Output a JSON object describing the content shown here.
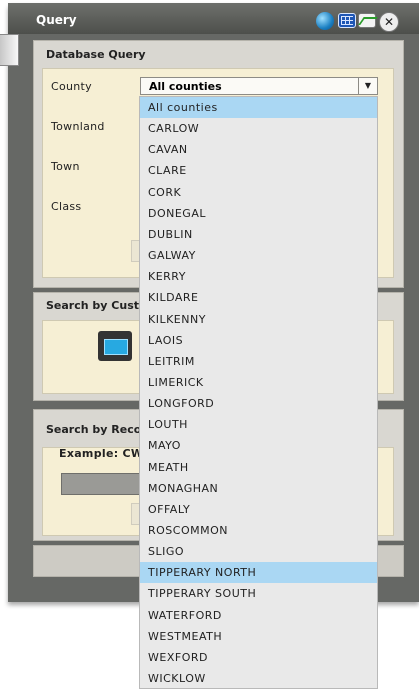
{
  "window": {
    "title": "Query"
  },
  "database_query": {
    "heading": "Database Query",
    "county_label": "County",
    "townland_label": "Townland",
    "town_label": "Town",
    "class_label": "Class",
    "county_value": "All counties"
  },
  "search_custom": {
    "heading": "Search by Custo"
  },
  "search_record": {
    "heading": "Search by Recor",
    "example": "Example: CW0"
  },
  "county_options": [
    "All counties",
    "CARLOW",
    "CAVAN",
    "CLARE",
    "CORK",
    "DONEGAL",
    "DUBLIN",
    "GALWAY",
    "KERRY",
    "KILDARE",
    "KILKENNY",
    "LAOIS",
    "LEITRIM",
    "LIMERICK",
    "LONGFORD",
    "LOUTH",
    "MAYO",
    "MEATH",
    "MONAGHAN",
    "OFFALY",
    "ROSCOMMON",
    "SLIGO",
    "TIPPERARY NORTH",
    "TIPPERARY SOUTH",
    "WATERFORD",
    "WESTMEATH",
    "WEXFORD",
    "WICKLOW"
  ],
  "highlighted_options": [
    "All counties",
    "TIPPERARY NORTH"
  ],
  "colors": {
    "highlight": "#aad7f3",
    "titlebar": "#4d4f4b",
    "panel": "#f6efd4"
  }
}
